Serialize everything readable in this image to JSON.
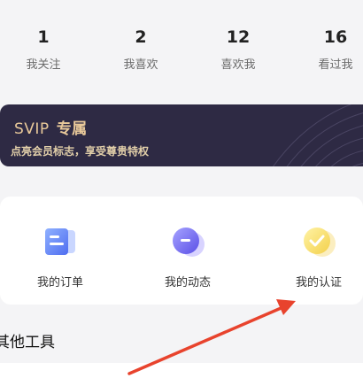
{
  "stats": [
    {
      "count": "1",
      "label": "我关注"
    },
    {
      "count": "2",
      "label": "我喜欢"
    },
    {
      "count": "12",
      "label": "喜欢我"
    },
    {
      "count": "16",
      "label": "看过我"
    }
  ],
  "svip": {
    "title": "SVIP",
    "title_suffix": "专属",
    "subtitle": "点亮会员标志，享受尊贵特权",
    "bg_color": "#2e2a44",
    "text_color": "#e9c99a"
  },
  "tools": [
    {
      "label": "我的订单",
      "icon": "order-icon"
    },
    {
      "label": "我的动态",
      "icon": "moments-icon"
    },
    {
      "label": "我的认证",
      "icon": "verify-icon"
    }
  ],
  "section": {
    "other_tools": "其他工具"
  },
  "annotation": {
    "arrow_color": "#e8432d"
  }
}
